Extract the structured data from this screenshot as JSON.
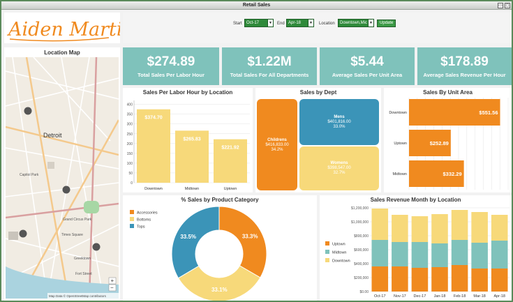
{
  "window": {
    "title": "Retail Sales"
  },
  "logo": {
    "text": "Aiden Martin"
  },
  "filters": {
    "start_label": "Start",
    "start_value": "Oct-17",
    "end_label": "End",
    "end_value": "Apr-18",
    "location_label": "Location",
    "location_value": "Downtown,Mic",
    "update_label": "Update"
  },
  "map": {
    "title": "Location Map",
    "city_label": "Detroit",
    "attribution": "Map Data © OpenStreetMap contributors",
    "zoom_in": "+",
    "zoom_out": "−",
    "labels": [
      "Grand Circus Park",
      "Times Square",
      "Greektown",
      "Fort Street",
      "Capitol Park"
    ]
  },
  "kpis": [
    {
      "value": "$274.89",
      "label": "Total Sales Per Labor Hour"
    },
    {
      "value": "$1.22M",
      "label": "Total Sales For All Departments"
    },
    {
      "value": "$5.44",
      "label": "Average Sales Per Unit Area"
    },
    {
      "value": "$178.89",
      "label": "Average Sales Revenue Per Hour"
    }
  ],
  "colors": {
    "orange": "#f08a1f",
    "teal": "#3b94b8",
    "yellow": "#f7d97a",
    "mint": "#7fc2bb"
  },
  "chart_data": [
    {
      "type": "bar",
      "title": "Sales Per Labor Hour by Location",
      "categories": [
        "Downtown",
        "Midtown",
        "Uptown"
      ],
      "values": [
        374.7,
        265.83,
        221.92
      ],
      "data_labels": [
        "$374.70",
        "$265.83",
        "$221.92"
      ],
      "yticks": [
        0,
        50,
        100,
        150,
        200,
        250,
        300,
        350,
        400
      ],
      "ylim": [
        0,
        420
      ]
    },
    {
      "type": "treemap",
      "title": "Sales by Dept",
      "items": [
        {
          "name": "Childrens",
          "value": "$416,833.00",
          "pct": "34.2%"
        },
        {
          "name": "Mens",
          "value": "$401,816.00",
          "pct": "33.0%"
        },
        {
          "name": "Womens",
          "value": "$398,547.00",
          "pct": "32.7%"
        }
      ]
    },
    {
      "type": "bar",
      "orientation": "horizontal",
      "title": "Sales By Unit Area",
      "categories": [
        "Downtown",
        "Uptown",
        "Midtown"
      ],
      "values": [
        551.56,
        252.89,
        332.29
      ],
      "data_labels": [
        "$551.56",
        "$252.89",
        "$332.29"
      ],
      "xlim": [
        0,
        600
      ]
    },
    {
      "type": "pie",
      "title": "% Sales by Product Category",
      "legend": [
        "Accessories",
        "Bottoms",
        "Tops"
      ],
      "values": [
        33.3,
        33.1,
        33.5
      ],
      "data_labels": [
        "33.3%",
        "33.1%",
        "33.5%"
      ]
    },
    {
      "type": "bar",
      "stacked": true,
      "title": "Sales Revenue Month by Location",
      "legend": [
        "Uptown",
        "Midtown",
        "Downtown"
      ],
      "categories": [
        "Oct-17",
        "Nov-17",
        "Dec-17",
        "Jan-18",
        "Feb-18",
        "Mar-18",
        "Apr-18"
      ],
      "tick_labels": [
        "Oct-17",
        "Nov-17",
        "Dec-17",
        "Jan-18",
        "Feb-18",
        "Mar-18",
        "Apr-18"
      ],
      "series": [
        {
          "name": "Uptown",
          "values": [
            360,
            360,
            340,
            350,
            380,
            330,
            330
          ]
        },
        {
          "name": "Midtown",
          "values": [
            380,
            350,
            370,
            340,
            360,
            370,
            400
          ]
        },
        {
          "name": "Downtown",
          "values": [
            450,
            390,
            370,
            420,
            430,
            440,
            370
          ]
        }
      ],
      "yticks": [
        "$0.00",
        "$200,000",
        "$400,000",
        "$600,000",
        "$800,000",
        "$1,000,000",
        "$1,200,000"
      ],
      "ylim": [
        0,
        1200
      ]
    }
  ]
}
